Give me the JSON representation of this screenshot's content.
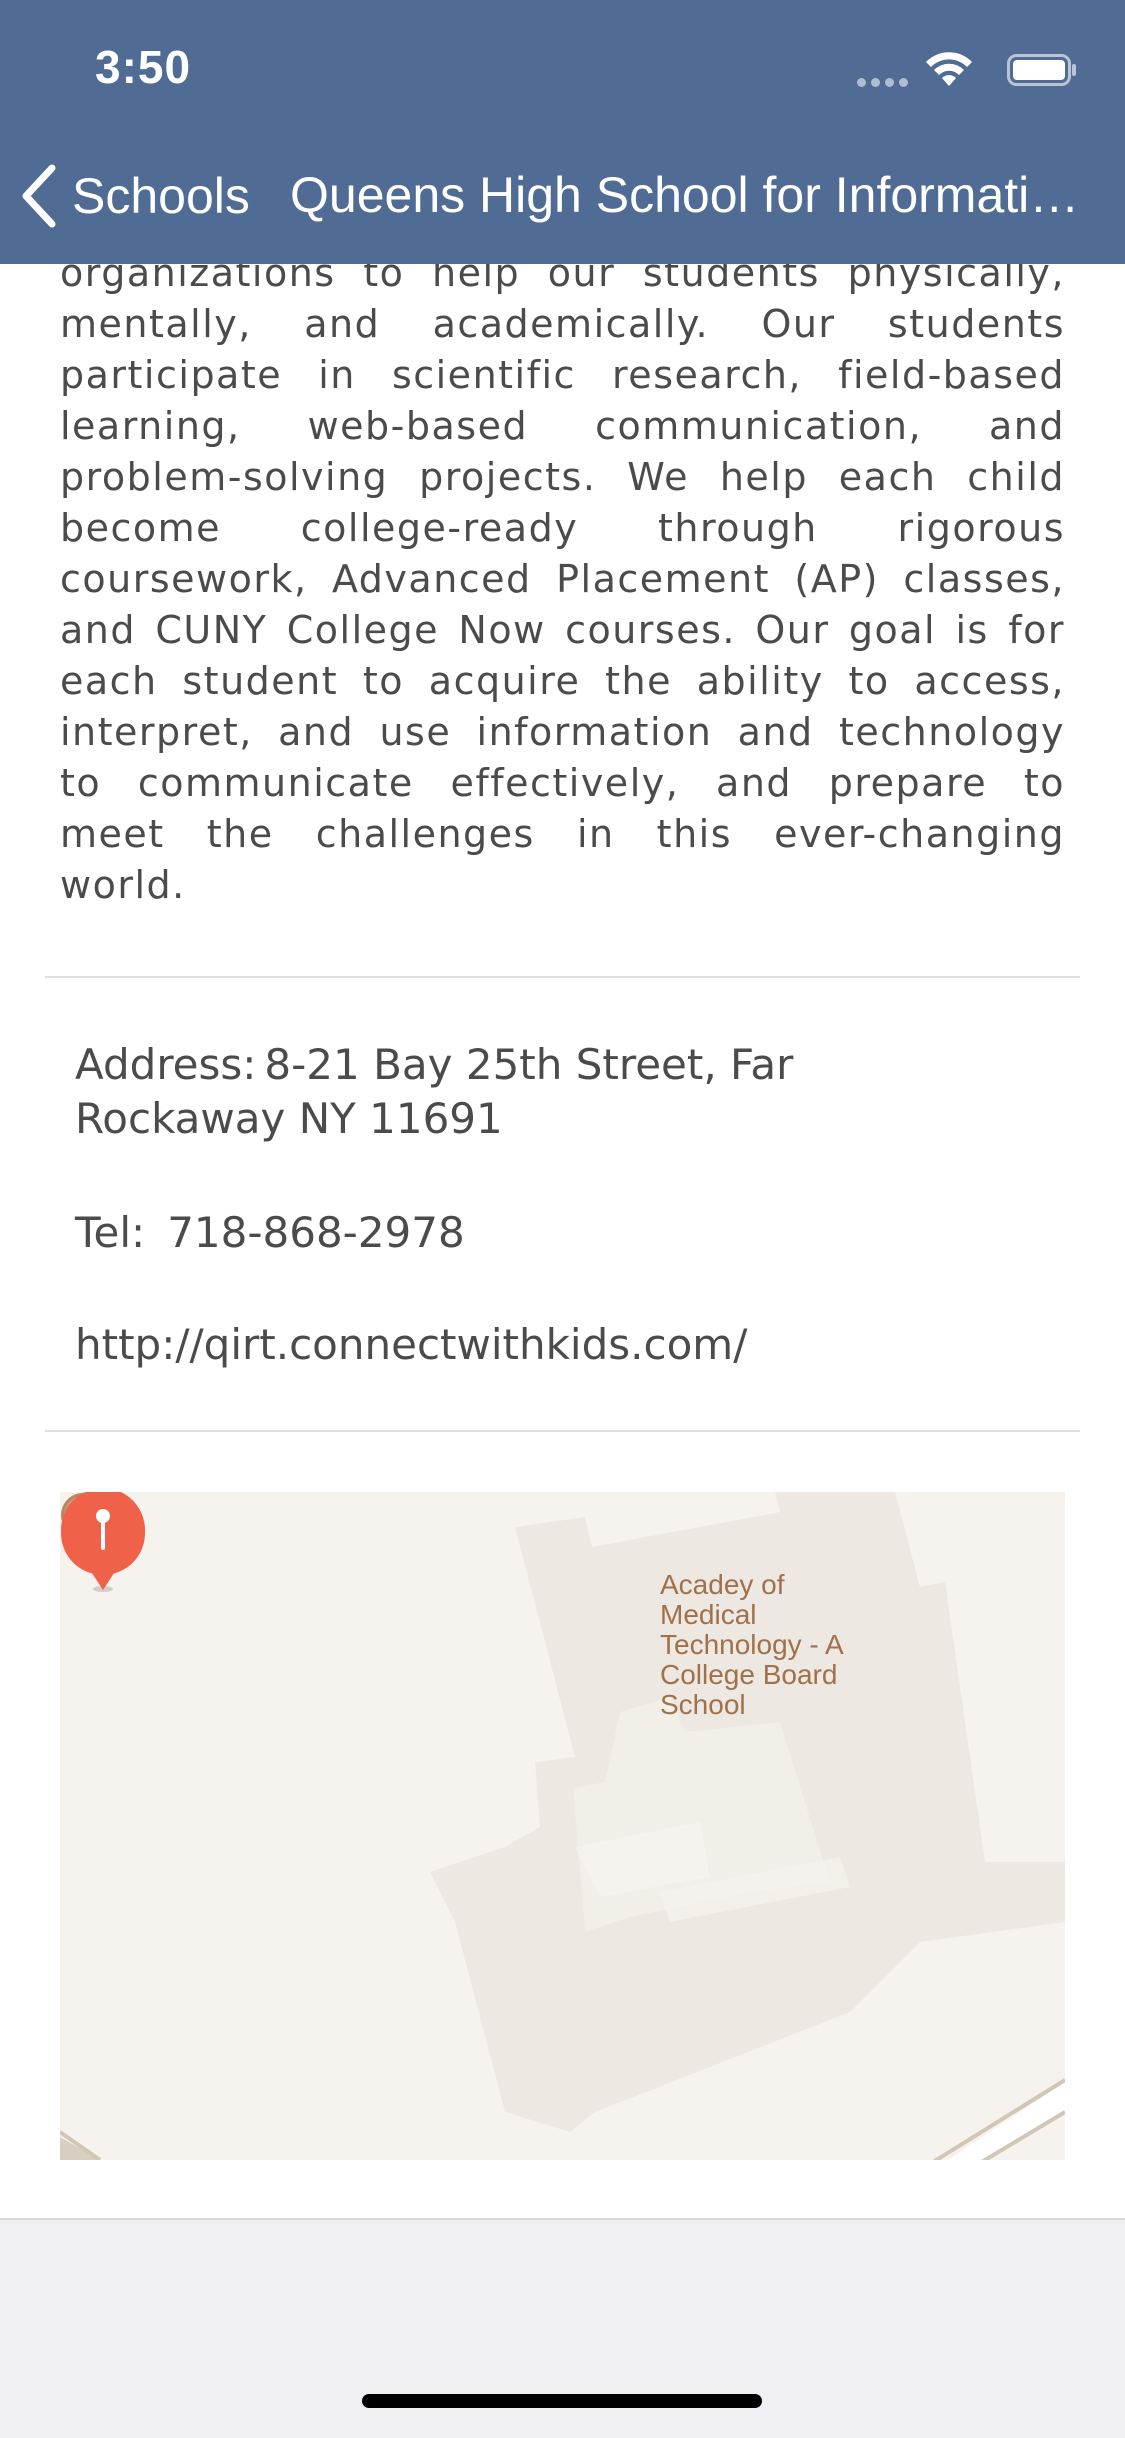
{
  "status_bar": {
    "time": "3:50"
  },
  "nav": {
    "back_label": "Schools",
    "title": "Queens High School for Information, Research, and Technology"
  },
  "about": {
    "text": "organizations to help our students physically, mentally, and academically. Our students participate in scientific research, field-based learning, web-based communication, and problem-solving projects. We help each child become college-ready through rigorous coursework, Advanced Placement (AP) classes, and CUNY College Now courses. Our goal is for each student to acquire the ability to access, interpret, and use information and technology to communicate effectively, and prepare to meet the challenges in this ever-changing world."
  },
  "contact": {
    "address_label": "Address:",
    "address_value": "8-21 Bay 25th Street, Far Rockaway NY 11691",
    "tel_label": "Tel:",
    "tel_value": "718-868-2978",
    "website": "http://qirt.connectwithkids.com/"
  },
  "map": {
    "poi_label": "Acadey of Medical Technology - A College Board School",
    "poi_icon": "graduation-cap-icon",
    "pin_icon": "map-pin-icon"
  },
  "colors": {
    "nav_bar": "#506c95",
    "pin": "#f0614a",
    "map_bg": "#f6f3ee",
    "building": "#ede8e1",
    "poi_text": "#a0714b"
  }
}
